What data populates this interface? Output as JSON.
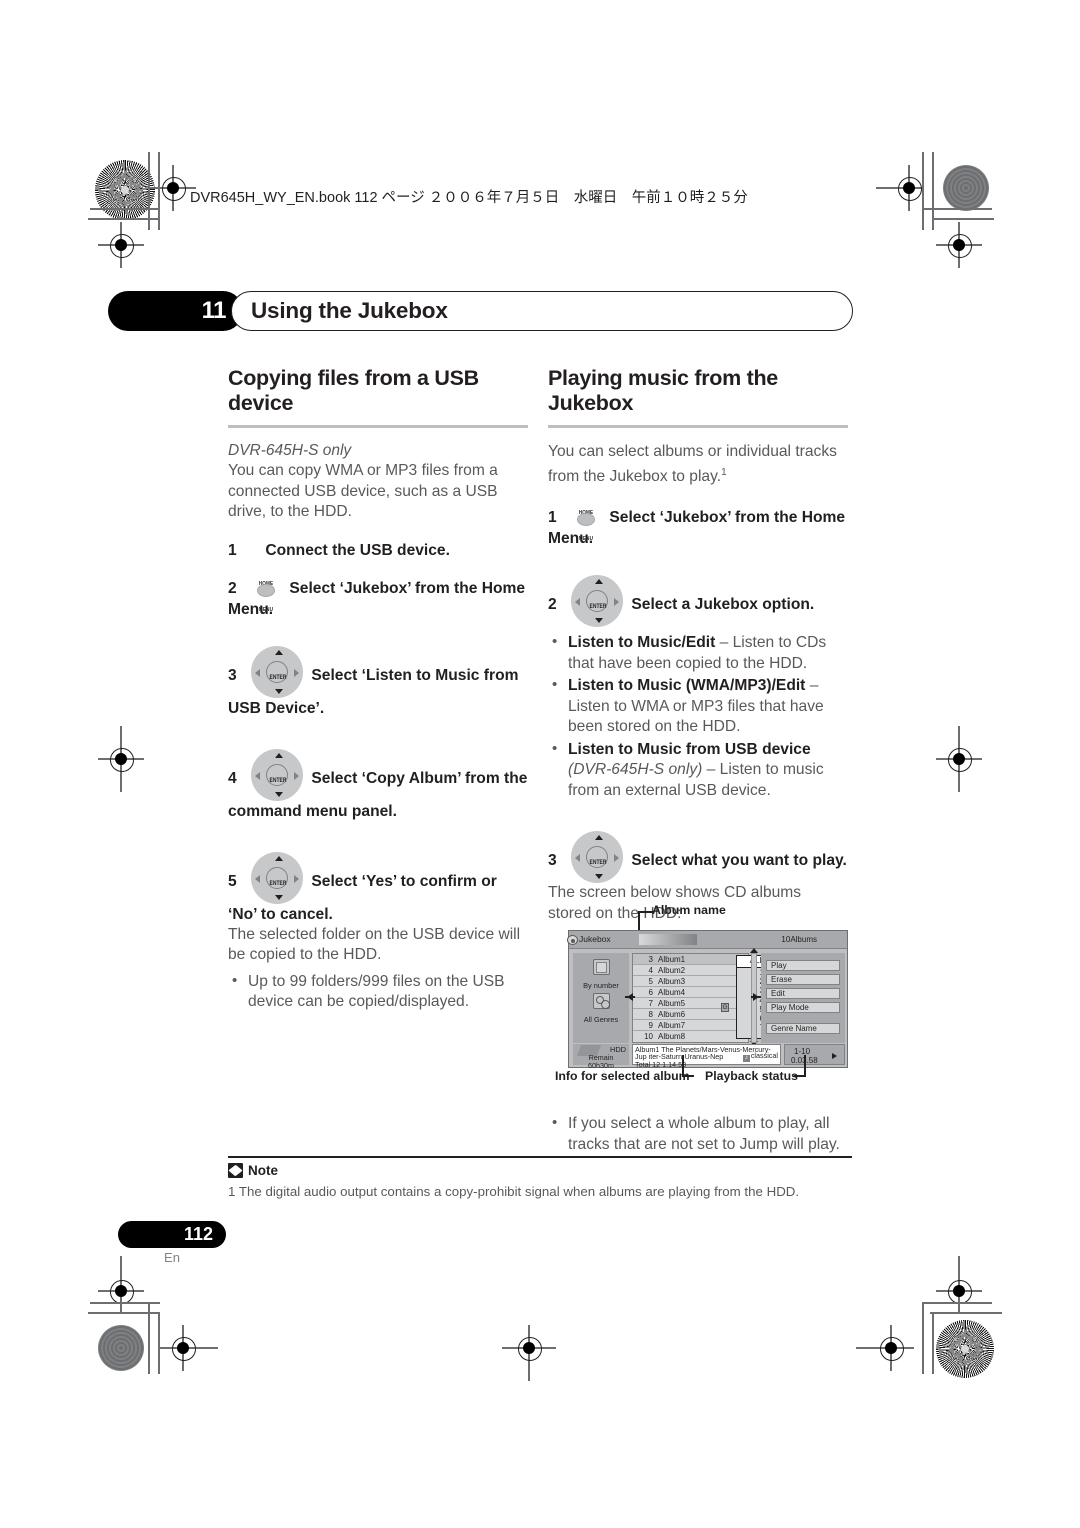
{
  "header": {
    "book_line": "DVR645H_WY_EN.book  112 ページ  ２００６年７月５日　水曜日　午前１０時２５分"
  },
  "chapter": {
    "number": "11",
    "title": "Using the Jukebox"
  },
  "left_column": {
    "heading": "Copying files from a USB device",
    "model_note": "DVR-645H-S only",
    "intro": "You can copy WMA or MP3 files from a connected USB device, such as a USB drive, to the HDD.",
    "steps": [
      {
        "num": "1",
        "icon": "none",
        "text": "Connect the USB device."
      },
      {
        "num": "2",
        "icon": "home-menu-button-icon",
        "icon_label": "HOME MENU",
        "text": "Select ‘Jukebox’ from the Home Menu."
      },
      {
        "num": "3",
        "icon": "enter-joypad-icon",
        "icon_label": "ENTER",
        "text": "Select ‘Listen to Music from USB Device’."
      },
      {
        "num": "4",
        "icon": "enter-joypad-icon",
        "icon_label": "ENTER",
        "text": "Select ‘Copy Album’ from the command menu panel."
      },
      {
        "num": "5",
        "icon": "enter-joypad-icon",
        "icon_label": "ENTER",
        "text": "Select ‘Yes’ to confirm or ‘No’ to cancel."
      }
    ],
    "step5_after": "The selected folder on the USB device will be copied to the HDD.",
    "bullets": [
      "Up to 99 folders/999 files on the USB device can be copied/displayed."
    ]
  },
  "right_column": {
    "heading": "Playing music from the Jukebox",
    "intro": "You can select albums or individual tracks from the Jukebox to play.",
    "intro_footnote": "1",
    "steps": [
      {
        "num": "1",
        "icon": "home-menu-button-icon",
        "icon_label": "HOME MENU",
        "text": "Select ‘Jukebox’ from the Home Menu."
      },
      {
        "num": "2",
        "icon": "enter-joypad-icon",
        "icon_label": "ENTER",
        "text": "Select a Jukebox option."
      },
      {
        "num": "3",
        "icon": "enter-joypad-icon",
        "icon_label": "ENTER",
        "text": "Select what you want to play."
      }
    ],
    "options": [
      {
        "bold": "Listen to Music/Edit",
        "rest": " – Listen to CDs that have been copied to the HDD."
      },
      {
        "bold": "Listen to Music (WMA/MP3)/Edit",
        "rest": " – Listen to WMA or MP3 files that have been stored on the HDD."
      },
      {
        "bold": "Listen to Music from USB device",
        "italic": " (DVR-645H-S only)",
        "rest": " – Listen to music from an external USB device."
      }
    ],
    "step3_after": "The screen below shows CD albums stored on the HDD:",
    "bullets": [
      "If you select a whole album to play, all tracks that are not set to Jump will play."
    ]
  },
  "figure": {
    "callouts": {
      "album_name": "Album name",
      "info_for_album": "Info for selected album",
      "playback_status": "Playback status"
    },
    "screen": {
      "title": "Jukebox",
      "album_count": "10Albums",
      "side_icons": [
        {
          "icon": "folder-icon",
          "label": "By number"
        },
        {
          "icon": "genre-icon",
          "label": "All Genres"
        }
      ],
      "hdd": {
        "label": "HDD",
        "remain_line1": "Remain",
        "remain_line2": "60h30m"
      },
      "albums": [
        {
          "num": "3",
          "name": "Album1"
        },
        {
          "num": "4",
          "name": "Album2"
        },
        {
          "num": "5",
          "name": "Album3"
        },
        {
          "num": "6",
          "name": "Album4"
        },
        {
          "num": "7",
          "name": "Album5"
        },
        {
          "num": "8",
          "name": "Album6"
        },
        {
          "num": "9",
          "name": "Album7"
        },
        {
          "num": "10",
          "name": "Album8"
        }
      ],
      "number_column": {
        "selected": "ALL",
        "values": [
          "1",
          "2",
          "3",
          "4",
          "5",
          "6",
          "7"
        ],
        "chip": "G"
      },
      "commands": [
        "Play",
        "Erase",
        "Edit",
        "Play Mode"
      ],
      "genre_button": "Genre Name",
      "info": {
        "line1": "Album1  The Planets/Mars-Venus-Mercury-Jup",
        "line2": "iter-Saturn-Uranus-Nep",
        "genre": "classical",
        "line3": "Total 12  1.14.58"
      },
      "status": {
        "range": "1-10",
        "time": "0.03.58"
      }
    }
  },
  "note": {
    "label": "Note",
    "text": "1 The digital audio output contains a copy-prohibit signal when albums are playing from the HDD."
  },
  "footer": {
    "page_number": "112",
    "language": "En"
  }
}
